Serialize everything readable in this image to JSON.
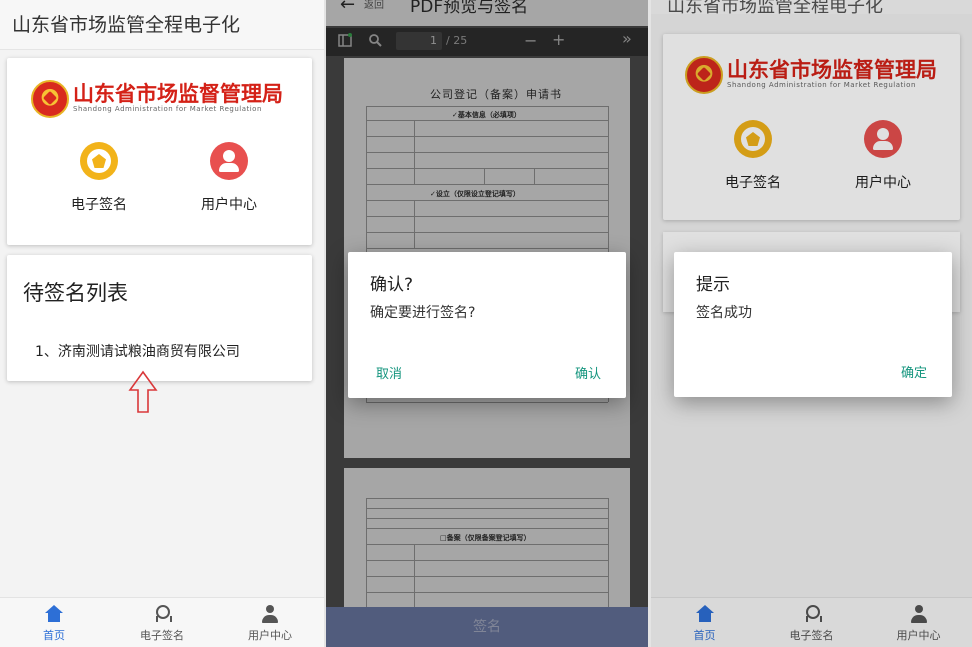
{
  "screen1": {
    "app_title": "山东省市场监管全程电子化",
    "logo": {
      "cn": "山东省市场监督管理局",
      "en": "Shandong Administration for Market Regulation"
    },
    "features": [
      {
        "label": "电子签名",
        "icon": "seal-icon"
      },
      {
        "label": "用户中心",
        "icon": "user-icon"
      }
    ],
    "pending_list": {
      "title": "待签名列表",
      "items": [
        "1、济南测请试粮油商贸有限公司"
      ]
    },
    "bottom_nav": [
      {
        "label": "首页",
        "icon": "home-icon",
        "active": true
      },
      {
        "label": "电子签名",
        "icon": "medal-icon",
        "active": false
      },
      {
        "label": "用户中心",
        "icon": "user-icon",
        "active": false
      }
    ],
    "colors": {
      "accent": "#2d6fd6",
      "brand_red": "#d42117",
      "sign_yellow": "#f2b31a",
      "user_red": "#e8504f"
    }
  },
  "screen2": {
    "back_label": "返回",
    "title": "PDF预览与签名",
    "toolbar": {
      "page_current": "1",
      "page_total": "/ 25",
      "minus": "−",
      "plus": "+",
      "more": "»"
    },
    "document": {
      "title": "公司登记（备案）申请书",
      "section1": "✓基本信息（必填项）",
      "section2": "✓设立（仅限设立登记填写）",
      "section3": "□备案（仅限备案登记填写）"
    },
    "dialog": {
      "title": "确认?",
      "message": "确定要进行签名?",
      "cancel": "取消",
      "confirm": "确认"
    },
    "footer_button": "签名",
    "colors": {
      "dialog_button": "#14957e",
      "footer": "#7d8ec0"
    }
  },
  "screen3": {
    "app_title": "山东省市场监管全程电子化",
    "logo": {
      "cn": "山东省市场监督管理局",
      "en": "Shandong Administration for Market Regulation"
    },
    "features": [
      {
        "label": "电子签名",
        "icon": "seal-icon"
      },
      {
        "label": "用户中心",
        "icon": "user-icon"
      }
    ],
    "dialog": {
      "title": "提示",
      "message": "签名成功",
      "ok": "确定"
    },
    "bottom_nav": [
      {
        "label": "首页",
        "icon": "home-icon",
        "active": true
      },
      {
        "label": "电子签名",
        "icon": "medal-icon",
        "active": false
      },
      {
        "label": "用户中心",
        "icon": "user-icon",
        "active": false
      }
    ]
  }
}
